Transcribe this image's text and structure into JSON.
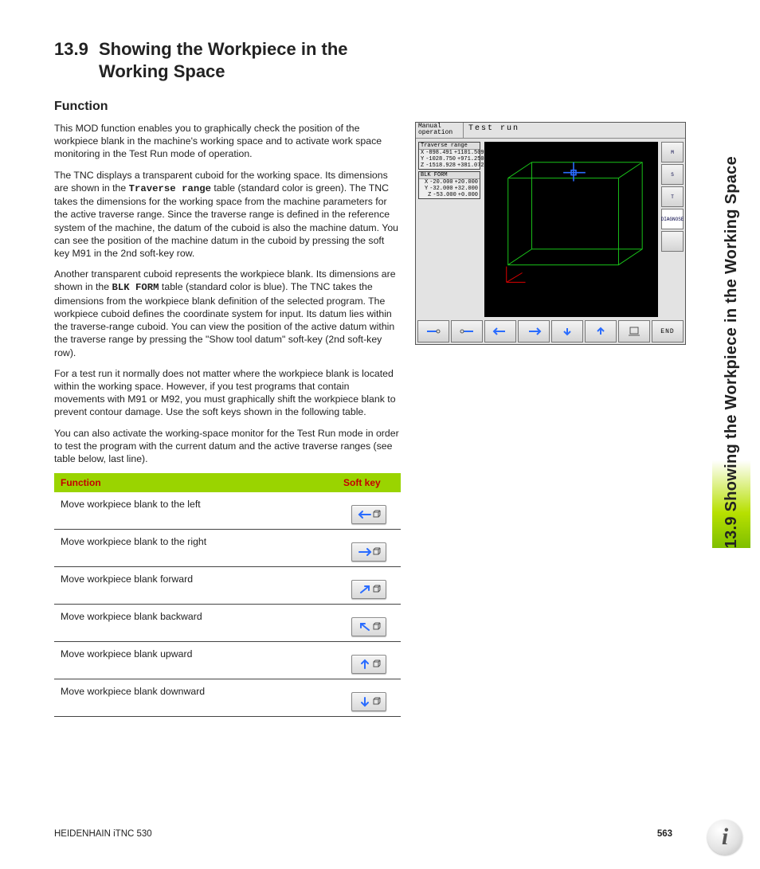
{
  "sideTab": "13.9 Showing the Workpiece in the Working Space",
  "title": {
    "num": "13.9",
    "text": "Showing the Workpiece in the Working Space"
  },
  "subhead": "Function",
  "para1": "This MOD function enables you to graphically check the position of the workpiece blank in the machine's working space and to activate work space monitoring in the Test Run mode of operation.",
  "para2a": "The TNC displays a transparent cuboid for the working space. Its dimensions are shown in the ",
  "para2m": "Traverse range",
  "para2b": " table (standard color is green). The TNC takes the dimensions for the working space from the machine parameters for the active traverse range. Since the traverse range is defined in the reference system of the machine, the datum of the cuboid is also the machine datum. You can see the position of the machine datum in the cuboid by pressing the soft key M91 in the 2nd soft-key row.",
  "para3a": "Another transparent cuboid represents the workpiece blank. Its dimensions are shown in the ",
  "para3m": "BLK FORM",
  "para3b": " table (standard color is blue). The TNC takes the dimensions from the workpiece blank definition of the selected program. The workpiece cuboid defines the coordinate system for input. Its datum lies within the traverse-range cuboid. You can view the position of the active datum within the traverse range by pressing the \"Show tool datum\" soft-key (2nd soft-key row).",
  "para4": "For a test run it normally does not matter where the workpiece blank is located within the working space. However, if you test programs that contain movements with M91 or M92, you must graphically shift the workpiece blank to prevent contour damage. Use the soft keys shown in the following table.",
  "para5": "You can also activate the working-space monitor for the Test Run mode in order to test the program with the current datum and the active traverse ranges (see table below, last line).",
  "tbl": {
    "h1": "Function",
    "h2": "Soft key",
    "rows": [
      {
        "f": "Move workpiece blank to the left",
        "icon": "left"
      },
      {
        "f": "Move workpiece blank to the right",
        "icon": "right"
      },
      {
        "f": "Move workpiece blank forward",
        "icon": "fwd"
      },
      {
        "f": "Move workpiece blank backward",
        "icon": "back"
      },
      {
        "f": "Move workpiece blank upward",
        "icon": "up"
      },
      {
        "f": "Move workpiece blank downward",
        "icon": "down"
      }
    ]
  },
  "screenshot": {
    "mode": "Manual operation",
    "title": "Test run",
    "trav": {
      "title": "Traverse range",
      "rows": [
        [
          "X",
          "-898.491",
          "+1101.509"
        ],
        [
          "Y",
          "-1028.750",
          "+971.250"
        ],
        [
          "Z",
          "-1518.928",
          "+381.072"
        ]
      ]
    },
    "blk": {
      "title": "BLK FORM",
      "rows": [
        [
          "X",
          "-20.000",
          "+20.000"
        ],
        [
          "Y",
          "-32.000",
          "+32.000"
        ],
        [
          "Z",
          "-53.000",
          "+0.000"
        ]
      ]
    },
    "rbtn": [
      "M",
      "S",
      "T",
      "DIAGNOSE",
      ""
    ],
    "end": "END"
  },
  "footer": {
    "left": "HEIDENHAIN iTNC 530",
    "page": "563"
  }
}
